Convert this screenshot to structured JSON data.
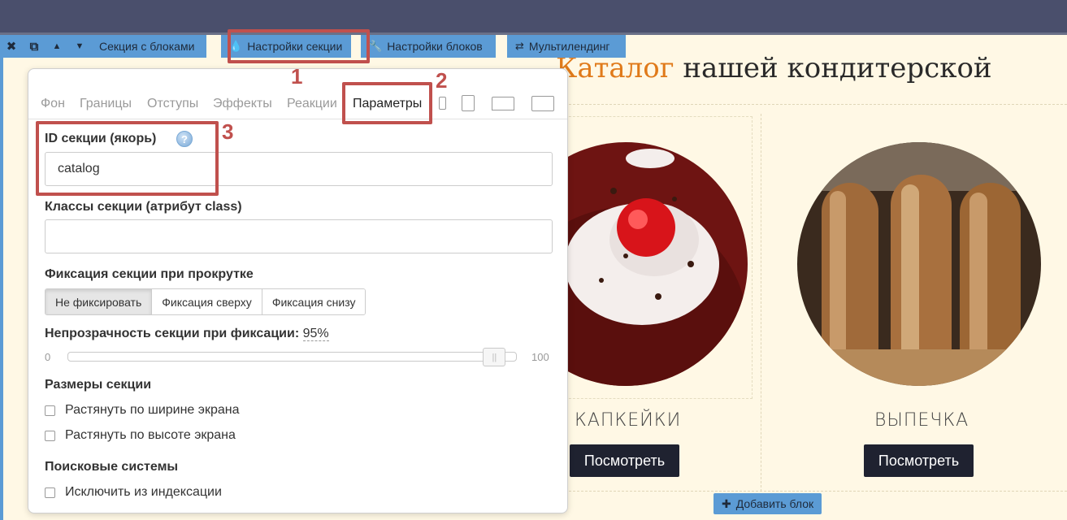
{
  "toolbar": {
    "close_icon": "✖",
    "copy_icon": "⧉",
    "up_icon": "▲",
    "down_icon": "▼",
    "section_label": "Секция с блоками",
    "section_settings_label": "Настройки секции",
    "blocks_settings_label": "Настройки блоков",
    "multilanding_label": "Мультилендинг"
  },
  "annotations": {
    "n1": "1",
    "n2": "2",
    "n3": "3"
  },
  "headline": {
    "accent": "Каталог",
    "rest": " нашей кондитерской"
  },
  "cards": [
    {
      "title": "КАПКЕЙКИ",
      "button": "Посмотреть"
    },
    {
      "title": "ВЫПЕЧКА",
      "button": "Посмотреть"
    }
  ],
  "add_block_label": "Добавить блок",
  "panel": {
    "tabs": [
      "Фон",
      "Границы",
      "Отступы",
      "Эффекты",
      "Реакции",
      "Параметры"
    ],
    "active_tab": "Параметры",
    "section_id_label": "ID секции (якорь)",
    "help_glyph": "?",
    "section_id_value": "catalog",
    "classes_label": "Классы секции (атрибут class)",
    "classes_value": "",
    "fixation_label": "Фиксация секции при прокрутке",
    "fixation_options": [
      "Не фиксировать",
      "Фиксация сверху",
      "Фиксация снизу"
    ],
    "fixation_selected": "Не фиксировать",
    "opacity_label": "Непрозрачность секции при фиксации:",
    "opacity_value": "95%",
    "opacity_fraction": 0.95,
    "slider_min": "0",
    "slider_max": "100",
    "sizes_label": "Размеры секции",
    "stretch_width": "Растянуть по ширине экрана",
    "stretch_height": "Растянуть по высоте экрана",
    "search_label": "Поисковые системы",
    "exclude_index": "Исключить из индексации"
  }
}
